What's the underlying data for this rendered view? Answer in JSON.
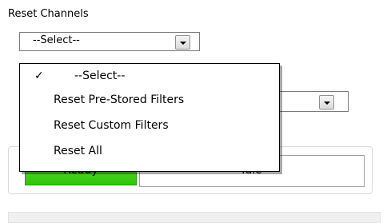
{
  "reset_channels": {
    "label": "Reset Channels",
    "selected": "--Select--"
  },
  "second_select": {
    "selected": ""
  },
  "dropdown_menu": {
    "items": [
      {
        "label": "--Select--",
        "checked": "✓"
      },
      {
        "label": "Reset Pre-Stored Filters"
      },
      {
        "label": "Reset Custom Filters"
      },
      {
        "label": "Reset All"
      }
    ]
  },
  "status": {
    "ready_label": "Ready",
    "state_label": "Idle",
    "ready_color": "#3fd116"
  }
}
